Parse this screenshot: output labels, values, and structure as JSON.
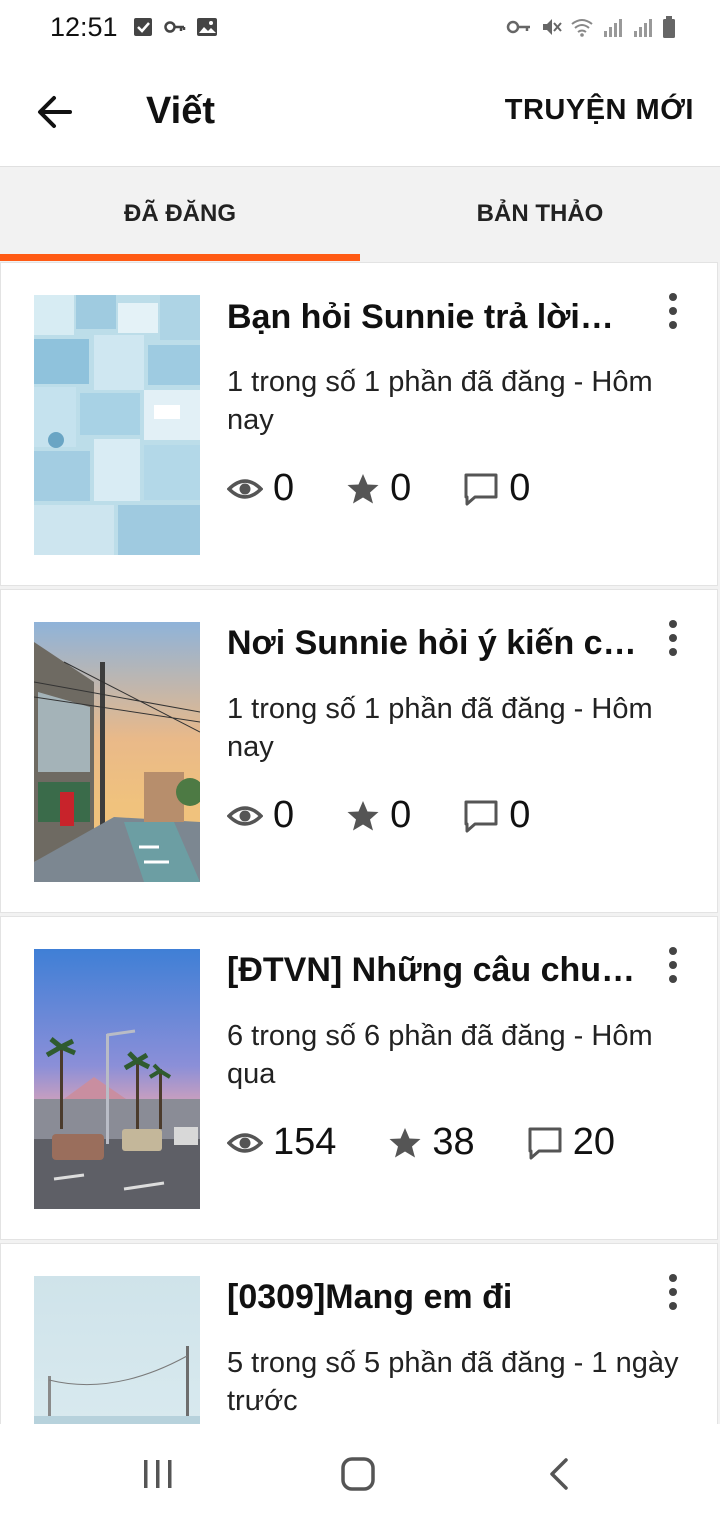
{
  "status_bar": {
    "time": "12:51",
    "left_icons": [
      "checkbox-icon",
      "key-icon",
      "image-icon"
    ],
    "right_icons": [
      "vpn-key-icon",
      "mute-icon",
      "wifi-icon",
      "signal-icon",
      "signal-icon",
      "battery-icon"
    ]
  },
  "app_bar": {
    "back_icon": "arrow-left-icon",
    "title": "Viết",
    "new_story_label": "TRUYỆN MỚI"
  },
  "tabs": [
    {
      "label": "ĐÃ ĐĂNG",
      "active": true
    },
    {
      "label": "BẢN THẢO",
      "active": false
    }
  ],
  "accent_color": "#ff5a14",
  "stories": [
    {
      "title": "Bạn hỏi Sunnie trả lời🐰…",
      "meta": "1 trong số 1 phần đã đăng - Hôm nay",
      "views": "0",
      "votes": "0",
      "comments": "0"
    },
    {
      "title": "Nơi Sunnie hỏi ý kiến củ…",
      "meta": "1 trong số 1 phần đã đăng - Hôm nay",
      "views": "0",
      "votes": "0",
      "comments": "0"
    },
    {
      "title": "[ĐTVN] Những câu chuy…",
      "meta": "6 trong số 6 phần đã đăng - Hôm qua",
      "views": "154",
      "votes": "38",
      "comments": "20"
    },
    {
      "title": "[0309]Mang em đi",
      "meta": "5 trong số 5 phần đã đăng - 1 ngày trước",
      "views": "",
      "votes": "",
      "comments": ""
    }
  ],
  "nav_bar": {
    "icons": [
      "recent-apps-icon",
      "home-icon",
      "back-icon"
    ]
  }
}
